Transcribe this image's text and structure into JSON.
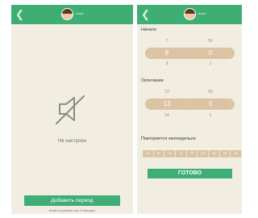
{
  "colors": {
    "header": "#3fae74",
    "background": "#f1eee1",
    "picker_band": "#dcc3a3",
    "alert": "#d44d3a"
  },
  "left_screen": {
    "header": {
      "back_icon": "back-arrow-icon",
      "username": "Анна"
    },
    "empty_icon": "muted-bell-icon",
    "empty_text": "Не настроен",
    "add_button": "Добавить период",
    "footnote": {
      "before": "Можете добавить еще ",
      "count": "5",
      "after": " периодов"
    }
  },
  "right_screen": {
    "header": {
      "back_icon": "back-arrow-icon",
      "username": "Анна"
    },
    "start": {
      "label": "Начало",
      "hours": {
        "prev": "7",
        "current": "8",
        "next": "9"
      },
      "minutes": {
        "prev": "59",
        "current": "0",
        "next": "1"
      },
      "separator": ":"
    },
    "end": {
      "label": "Окончание",
      "hours": {
        "prev": "12",
        "current": "13",
        "next": "14"
      },
      "minutes": {
        "prev": "59",
        "current": "0",
        "next": "1"
      },
      "separator": ":"
    },
    "repeat": {
      "label": "Повторяется еженедельно",
      "days": [
        "Пн",
        "Вт",
        "Ср",
        "Чт",
        "Пт",
        "Сб",
        "Вс",
        "Пн",
        "Вт"
      ]
    },
    "done_button": "ГОТОВО"
  }
}
